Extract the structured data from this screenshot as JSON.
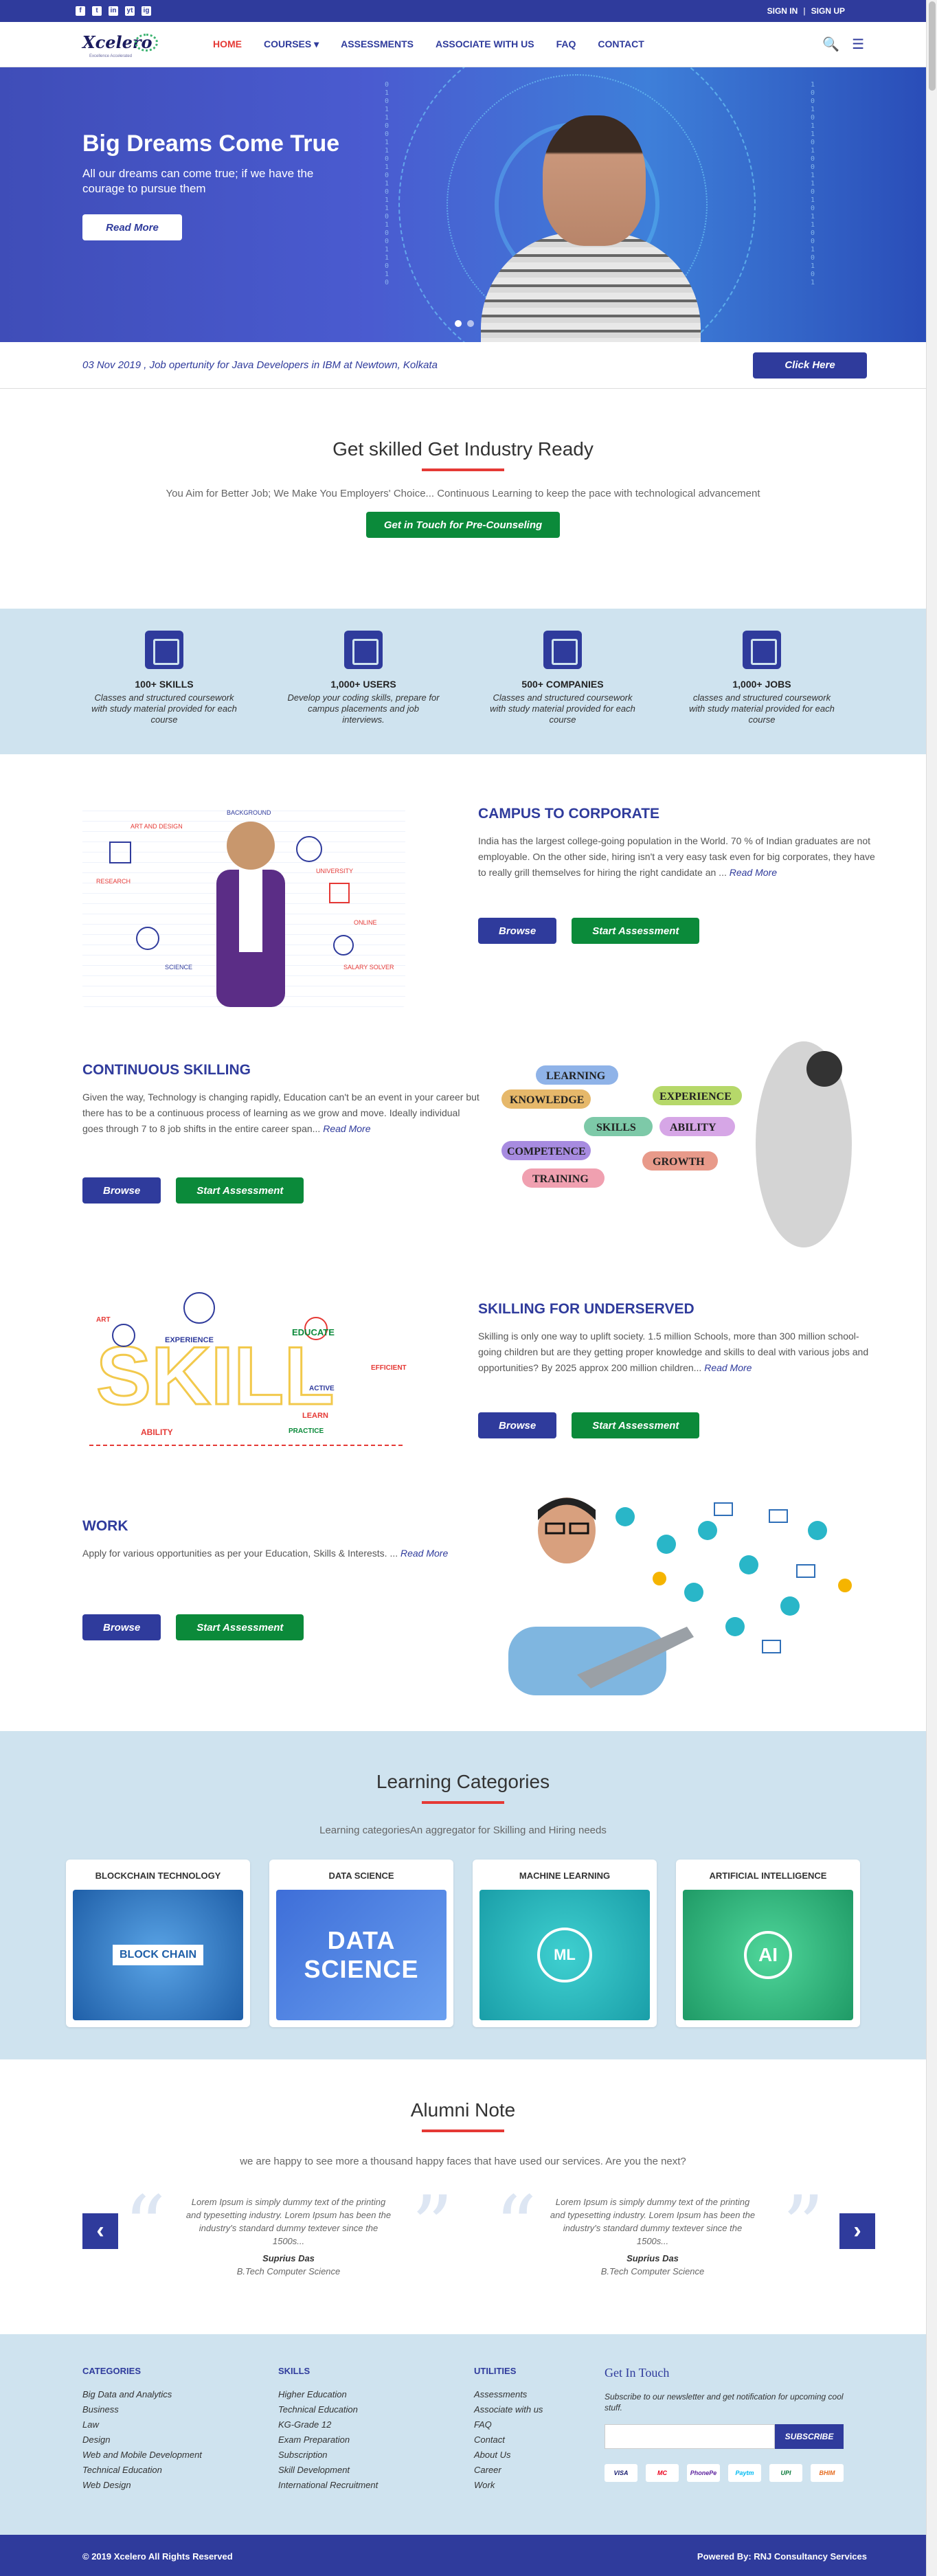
{
  "topbar": {
    "social": [
      "f",
      "t",
      "in",
      "yt",
      "ig"
    ],
    "sign_in": "SIGN IN",
    "sep": "|",
    "sign_up": "SIGN UP"
  },
  "nav": {
    "logo": "Xcelero",
    "logo_tag": "Excellence Accelerated",
    "items": [
      "HOME",
      "COURSES ▾",
      "ASSESSMENTS",
      "ASSOCIATE WITH US",
      "FAQ",
      "CONTACT"
    ],
    "active": "HOME",
    "search_icon": "🔍",
    "menu_icon": "☰"
  },
  "hero": {
    "title": "Big Dreams Come True",
    "text": "All our dreams can come true; if we have the courage to pursue them",
    "button": "Read More",
    "slides": 2,
    "active_slide": 1
  },
  "ticker": {
    "text": "03 Nov 2019 , Job opertunity for Java Developers  in IBM at Newtown, Kolkata",
    "button": "Click Here"
  },
  "intro": {
    "title": "Get skilled Get Industry Ready",
    "subtitle": "You Aim for Better Job; We Make You Employers' Choice... Continuous Learning to keep the pace with technological advancement",
    "button": "Get in Touch for Pre-Counseling"
  },
  "stats": [
    {
      "icon": "book-icon",
      "title": "100+ SKILLS",
      "desc": "Classes and structured coursework with study material provided for each course"
    },
    {
      "icon": "network-users-icon",
      "title": "1,000+ USERS",
      "desc": "Develop your coding skills, prepare for campus placements and job interviews."
    },
    {
      "icon": "buildings-icon",
      "title": "500+ COMPANIES",
      "desc": "Classes and structured coursework with study material provided for each course"
    },
    {
      "icon": "briefcase-icon",
      "title": "1,000+ JOBS",
      "desc": "classes and structured coursework with study material provided for each course"
    }
  ],
  "features": [
    {
      "title": "CAMPUS TO CORPORATE",
      "body": "India has the largest college-going population in the World. 70 % of Indian graduates are not employable. On the other side, hiring isn't a very easy task even for big corporates, they have to really grill themselves for hiring the right candidate an ...",
      "read_more": "Read More",
      "browse": "Browse",
      "assess": "Start Assessment"
    },
    {
      "title": "CONTINUOUS SKILLING",
      "body": "Given the way, Technology is changing rapidly, Education can't be an event in your career but there has to be a continuous process of learning as we grow and move. Ideally individual goes through 7 to 8 job shifts in the entire career span...",
      "read_more": "Read More",
      "browse": "Browse",
      "assess": "Start Assessment"
    },
    {
      "title": "SKILLING FOR UNDERSERVED",
      "body": "Skilling is only one way to uplift society. 1.5 million Schools, more than 300 million school-going children but are they getting proper knowledge and skills to deal with various jobs and opportunities? By 2025 approx 200 million children...",
      "read_more": "Read More",
      "browse": "Browse",
      "assess": "Start Assessment"
    },
    {
      "title": "WORK",
      "body": "Apply for various opportunities as per your Education, Skills & Interests. ...",
      "read_more": "Read More",
      "browse": "Browse",
      "assess": "Start Assessment"
    }
  ],
  "illus_words": {
    "skills_cloud": [
      "LEARNING",
      "KNOWLEDGE",
      "EXPERIENCE",
      "SKILLS",
      "ABILITY",
      "COMPETENCE",
      "GROWTH",
      "TRAINING"
    ],
    "skill_map": [
      "EXPERIENCE",
      "EDUCATE",
      "ACTIVE",
      "EFFICIENT",
      "LEARN",
      "PRACTICE",
      "ABILITY",
      "ART"
    ],
    "campus": [
      "RESEARCH",
      "ART AND DESIGN",
      "BACKGROUND",
      "UNIVERSITY",
      "SALARY SOLVER",
      "SCIENCE",
      "ONLINE"
    ]
  },
  "categories": {
    "title": "Learning Categories",
    "subtitle": "Learning categoriesAn aggregator for Skilling and Hiring needs",
    "cards": [
      {
        "title": "BLOCKCHAIN TECHNOLOGY",
        "label": "BLOCK CHAIN",
        "color": "#2d78c4"
      },
      {
        "title": "DATA SCIENCE",
        "label": "DATA SCIENCE",
        "color": "#4a7fe0"
      },
      {
        "title": "MACHINE LEARNING",
        "label": "ML",
        "color": "#24b5bf"
      },
      {
        "title": "ARTIFICIAL INTELLIGENCE",
        "label": "AI",
        "color": "#2fb27c"
      }
    ]
  },
  "alumni": {
    "title": "Alumni Note",
    "subtitle": "we are happy to see more a thousand happy faces that have used our services. Are you the next?",
    "prev": "‹",
    "next": "›",
    "quotes": [
      {
        "text": "Lorem Ipsum is simply dummy text of the printing and typesetting industry. Lorem Ipsum has been the industry's standard dummy textever since the 1500s...",
        "name": "Suprius Das",
        "role": "B.Tech Computer Science"
      },
      {
        "text": "Lorem Ipsum is simply dummy text of the printing and typesetting industry. Lorem Ipsum has been the industry's standard dummy textever since the 1500s...",
        "name": "Suprius Das",
        "role": "B.Tech Computer Science"
      }
    ]
  },
  "footer": {
    "columns": [
      {
        "title": "CATEGORIES",
        "links": [
          "Big Data and Analytics",
          "Business",
          "Law",
          "Design",
          "Web and Mobile Development",
          "Technical Education",
          "Web Design"
        ]
      },
      {
        "title": "SKILLS",
        "links": [
          "Higher Education",
          "Technical Education",
          "KG-Grade 12",
          "Exam Preparation",
          "Subscription",
          "Skill Development",
          "International Recruitment"
        ]
      },
      {
        "title": "UTILITIES",
        "links": [
          "Assessments",
          "Associate with us",
          "FAQ",
          "Contact",
          "About Us",
          "Career",
          "Work"
        ]
      }
    ],
    "get_in_touch": "Get In Touch",
    "newsletter": "Subscribe to our newsletter and get notification for upcoming cool stuff.",
    "subscribe": "SUBSCRIBE",
    "payments": [
      "VISA",
      "MC",
      "PhonePe",
      "Paytm",
      "UPI",
      "BHIM"
    ],
    "copyright": "© 2019 Xcelero All Rights Reserved",
    "powered": "Powered By:  RNJ Consultancy Services"
  }
}
